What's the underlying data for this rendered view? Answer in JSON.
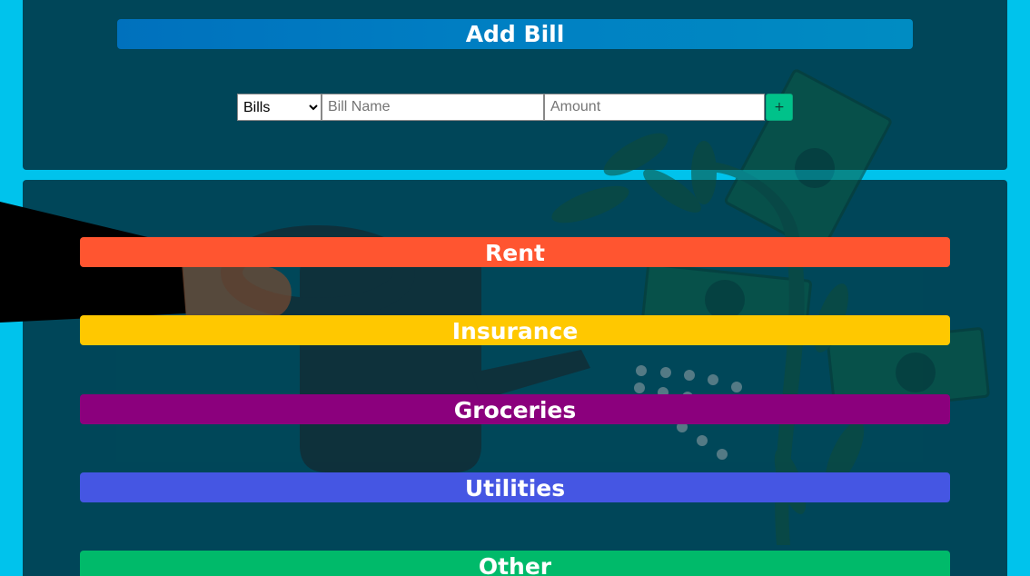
{
  "add_section": {
    "title": "Add Bill",
    "select": {
      "selected": "Bills",
      "options": [
        "Bills"
      ]
    },
    "name_placeholder": "Bill Name",
    "amount_placeholder": "Amount",
    "add_button_label": "+"
  },
  "categories": [
    {
      "label": "Rent",
      "color": "#ff5530"
    },
    {
      "label": "Insurance",
      "color": "#ffc800"
    },
    {
      "label": "Groceries",
      "color": "#8b007d"
    },
    {
      "label": "Utilities",
      "color": "#4556e3"
    },
    {
      "label": "Other",
      "color": "#00ba6a"
    }
  ],
  "colors": {
    "page_background": "#00c3ec",
    "panel_background": "#003c4c",
    "header_bar": "#0080c3",
    "add_button": "#00c28a"
  },
  "illustration": {
    "subject": "hand watering a money plant with a watering can"
  }
}
